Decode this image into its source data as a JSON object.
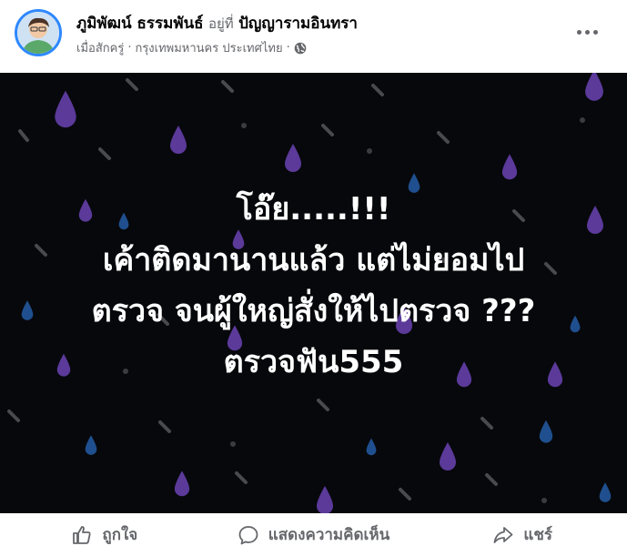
{
  "post": {
    "author": "ภูมิพัฒน์ ธรรมพันธ์",
    "at_label": "อยู่ที่",
    "place": "ปัญญารามอินทรา",
    "time": "เมื่อสักครู่",
    "location": "กรุงเทพมหานคร ประเทศไทย",
    "separator": "·",
    "privacy_icon": "globe-icon"
  },
  "image": {
    "lines": [
      "โอ๊ย.....!!!",
      "เค้าติดมานานแล้ว แต่ไม่ยอมไป",
      "ตรวจ จนผู้ใหญ่สั่งให้ไปตรวจ ???",
      "ตรวจฟัน555"
    ],
    "background_color": "#07080c",
    "text_color": "#ffffff",
    "drop_colors": [
      "#5b3a9a",
      "#1f4f8e",
      "#4a4a4e"
    ]
  },
  "actions": {
    "like_label": "ถูกใจ",
    "comment_label": "แสดงความคิดเห็น",
    "share_label": "แชร์"
  }
}
